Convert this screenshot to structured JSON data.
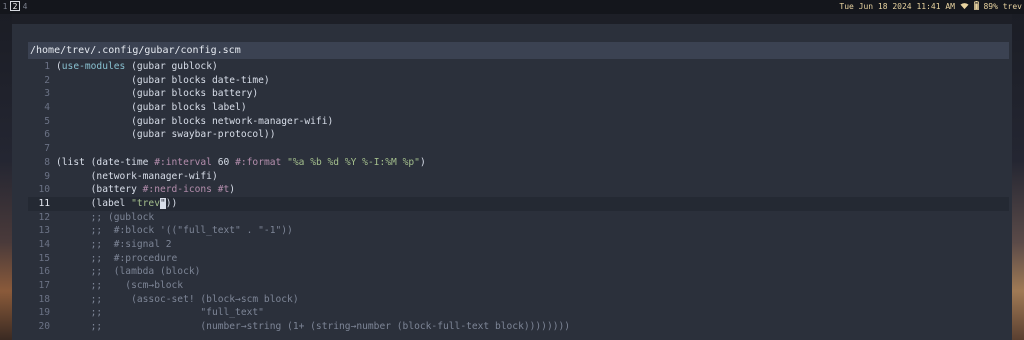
{
  "bar": {
    "workspaces": [
      {
        "label": "1",
        "active": false
      },
      {
        "label": "2",
        "active": true
      },
      {
        "label": "4",
        "active": false
      }
    ],
    "datetime": "Tue Jun 18 2024 11:41 AM",
    "wifi_icon": "wifi-icon",
    "battery_icon": "battery-icon",
    "battery": "89%",
    "user": "trev"
  },
  "editor": {
    "path": "/home/trev/.config/gubar/config.scm",
    "current_line": 11,
    "lines": [
      {
        "n": "1",
        "text": "(use-modules (gubar gublock)"
      },
      {
        "n": "2",
        "text": "             (gubar blocks date-time)"
      },
      {
        "n": "3",
        "text": "             (gubar blocks battery)"
      },
      {
        "n": "4",
        "text": "             (gubar blocks label)"
      },
      {
        "n": "5",
        "text": "             (gubar blocks network-manager-wifi)"
      },
      {
        "n": "6",
        "text": "             (gubar swaybar-protocol))"
      },
      {
        "n": "7",
        "text": ""
      },
      {
        "n": "8",
        "text": "(list (date-time #:interval 60 #:format \"%a %b %d %Y %-I:%M %p\")"
      },
      {
        "n": "9",
        "text": "      (network-manager-wifi)"
      },
      {
        "n": "10",
        "text": "      (battery #:nerd-icons #t)"
      },
      {
        "n": "11",
        "text": "      (label \"trev\"))"
      },
      {
        "n": "12",
        "text": "      ;; (gublock"
      },
      {
        "n": "13",
        "text": "      ;;  #:block '((\"full_text\" . \"-1\"))"
      },
      {
        "n": "14",
        "text": "      ;;  #:signal 2"
      },
      {
        "n": "15",
        "text": "      ;;  #:procedure"
      },
      {
        "n": "16",
        "text": "      ;;  (lambda (block)"
      },
      {
        "n": "17",
        "text": "      ;;    (scm→block"
      },
      {
        "n": "18",
        "text": "      ;;     (assoc-set! (block→scm block)"
      },
      {
        "n": "19",
        "text": "      ;;                 \"full_text\""
      },
      {
        "n": "20",
        "text": "      ;;                 (number→string (1+ (string→number (block-full-text block))))))))"
      }
    ]
  }
}
